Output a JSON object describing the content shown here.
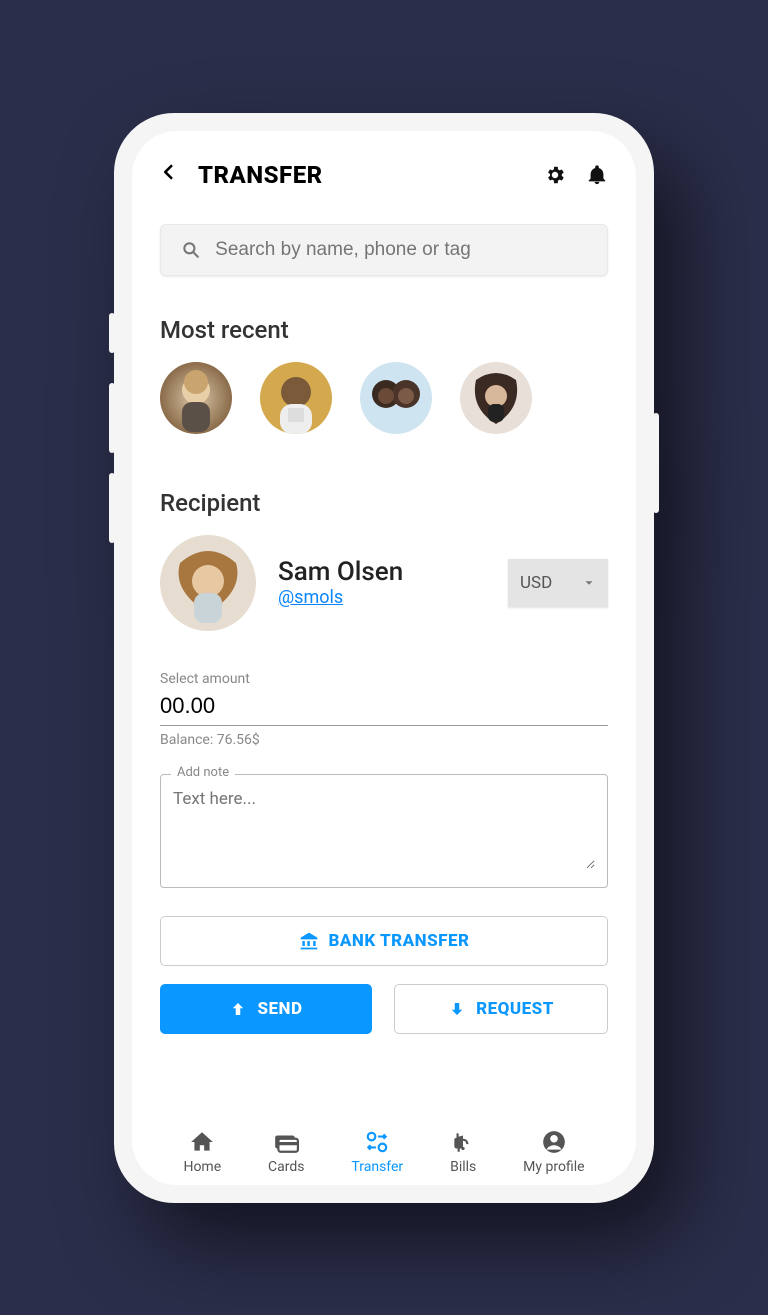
{
  "header": {
    "title": "TRANSFER"
  },
  "search": {
    "placeholder": "Search by name, phone or tag"
  },
  "sections": {
    "most_recent": "Most recent",
    "recipient": "Recipient"
  },
  "recipient": {
    "name": "Sam Olsen",
    "tag": "@smols",
    "currency": "USD"
  },
  "amount": {
    "label": "Select amount",
    "value": "00.00",
    "balance_label": "Balance: 76.56$"
  },
  "note": {
    "legend": "Add note",
    "placeholder": "Text here..."
  },
  "buttons": {
    "bank_transfer": "BANK TRANSFER",
    "send": "SEND",
    "request": "REQUEST"
  },
  "nav": {
    "home": "Home",
    "cards": "Cards",
    "transfer": "Transfer",
    "bills": "Bills",
    "profile": "My profile"
  }
}
